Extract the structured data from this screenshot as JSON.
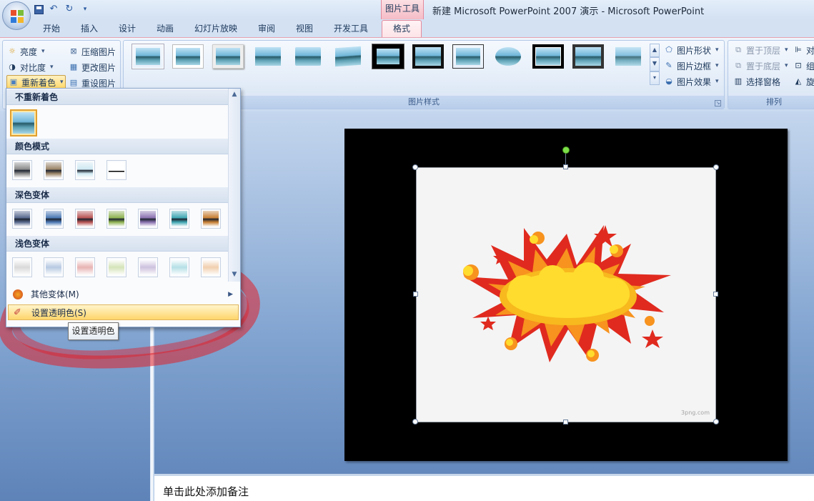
{
  "window": {
    "title": "新建 Microsoft PowerPoint 2007 演示 - Microsoft PowerPoint",
    "contextual_tab_group": "图片工具"
  },
  "quick_access": {
    "save_icon": "save-icon",
    "undo_icon": "undo-icon",
    "redo_icon": "redo-icon",
    "customize_icon": "chevron-down-icon"
  },
  "tabs": [
    {
      "label": "开始",
      "active": false
    },
    {
      "label": "插入",
      "active": false
    },
    {
      "label": "设计",
      "active": false
    },
    {
      "label": "动画",
      "active": false
    },
    {
      "label": "幻灯片放映",
      "active": false
    },
    {
      "label": "审阅",
      "active": false
    },
    {
      "label": "视图",
      "active": false
    },
    {
      "label": "开发工具",
      "active": false
    },
    {
      "label": "格式",
      "active": true
    }
  ],
  "ribbon": {
    "adjust": {
      "brightness": "亮度",
      "contrast": "对比度",
      "recolor": "重新着色",
      "compress": "压缩图片",
      "change_picture": "更改图片",
      "reset_picture": "重设图片"
    },
    "picture_styles": {
      "label": "图片样式",
      "shape": "图片形状",
      "border": "图片边框",
      "effects": "图片效果"
    },
    "arrange": {
      "label": "排列",
      "bring_front": "置于顶层",
      "send_back": "置于底层",
      "selection_pane": "选择窗格",
      "align": "对",
      "group": "组",
      "rotate": "旋"
    }
  },
  "recolor_menu": {
    "no_recolor": "不重新着色",
    "color_modes": "颜色模式",
    "dark_variations": "深色变体",
    "light_variations": "浅色变体",
    "more_variations": "其他变体(M)",
    "set_transparent": "设置透明色(S)",
    "tooltip": "设置透明色",
    "colors": {
      "color_modes": [
        "#8a8a8a",
        "#9b8567",
        "#cfe9f2",
        "#000000"
      ],
      "dark": [
        "#56678d",
        "#4a78b4",
        "#b85252",
        "#8fb351",
        "#8a71b0",
        "#3fa6b3",
        "#c77e32"
      ],
      "light": [
        "#d9d9d9",
        "#b6c9e2",
        "#e8b3b3",
        "#d5e4b9",
        "#cdc1de",
        "#b5e0e6",
        "#f1cfae"
      ]
    }
  },
  "slide": {
    "watermark": "3png.com",
    "notes_placeholder": "单击此处添加备注"
  }
}
